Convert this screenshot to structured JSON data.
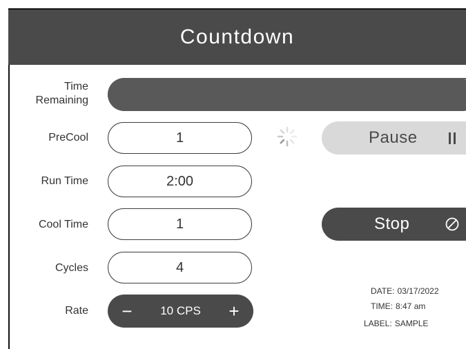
{
  "header": {
    "title": "Countdown"
  },
  "time_remaining": {
    "label": "Time\nRemaining",
    "progress_fraction": 1.0
  },
  "fields": {
    "precool": {
      "label": "PreCool",
      "value": "1"
    },
    "run_time": {
      "label": "Run Time",
      "value": "2:00"
    },
    "cool_time": {
      "label": "Cool Time",
      "value": "1"
    },
    "cycles": {
      "label": "Cycles",
      "value": "4"
    },
    "rate": {
      "label": "Rate",
      "value": "10 CPS",
      "minus": "−",
      "plus": "+"
    }
  },
  "controls": {
    "pause_label": "Pause",
    "stop_label": "Stop",
    "pause_icon": "pause-icon",
    "stop_icon": "stop-circle-slash-icon",
    "spinner_icon": "loading-spinner-icon"
  },
  "meta": {
    "date_key": "DATE:",
    "date_value": "03/17/2022",
    "time_key": "TIME:",
    "time_value": "8:47 am",
    "label_key": "LABEL:",
    "label_value": "SAMPLE"
  },
  "colors": {
    "header_bg": "#4a4a4a",
    "dark_control": "#4a4a4a",
    "progress": "#595959",
    "pause_bg": "#d9d9d9"
  }
}
